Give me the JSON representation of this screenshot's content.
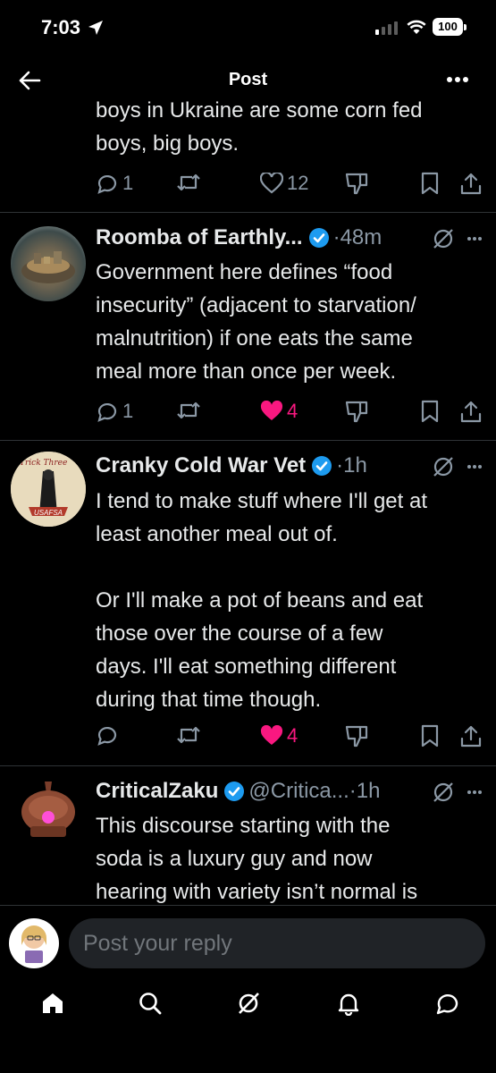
{
  "status_bar": {
    "time": "7:03",
    "battery": "100"
  },
  "header": {
    "title": "Post"
  },
  "main_post": {
    "text_lines": [
      "boys in Ukraine are some corn fed",
      "boys, big boys."
    ],
    "replies": "1",
    "likes": "12"
  },
  "replies": [
    {
      "name": "Roomba of Earthly...",
      "handle": "",
      "time": "·48m",
      "text_lines": [
        "Government here defines “food",
        "insecurity” (adjacent to starvation/",
        "malnutrition) if one eats the same",
        "meal more than once per week."
      ],
      "reply_count": "1",
      "likes": "4"
    },
    {
      "name": "Cranky Cold War Vet",
      "handle": "",
      "time": "·1h",
      "avatar_text": [
        "Trick Three",
        "USAFSA"
      ],
      "text_lines": [
        "I tend to make stuff where I'll get at",
        "least another meal out of.",
        "",
        "Or I'll make a pot of beans and eat",
        "those over the course of a few",
        "days. I'll eat something different",
        "during that time though."
      ],
      "reply_count": "",
      "likes": "4"
    },
    {
      "name": "CriticalZaku",
      "handle": "@Critica...",
      "time": "·1h",
      "text_lines": [
        "This discourse starting with the",
        "soda is a luxury guy and now",
        "hearing with variety isn’t normal is"
      ]
    }
  ],
  "reply_box": {
    "placeholder": "Post your reply"
  },
  "colors": {
    "background": "#000000",
    "like": "#f91880",
    "verified": "#1d9bf0",
    "muted": "#8b98a5"
  },
  "icons": [
    "back-arrow-icon",
    "more-icon",
    "reply-icon",
    "repost-icon",
    "like-icon",
    "downvote-icon",
    "bookmark-icon",
    "share-icon",
    "grok-icon",
    "home-icon",
    "search-icon",
    "notifications-icon",
    "messages-icon"
  ]
}
